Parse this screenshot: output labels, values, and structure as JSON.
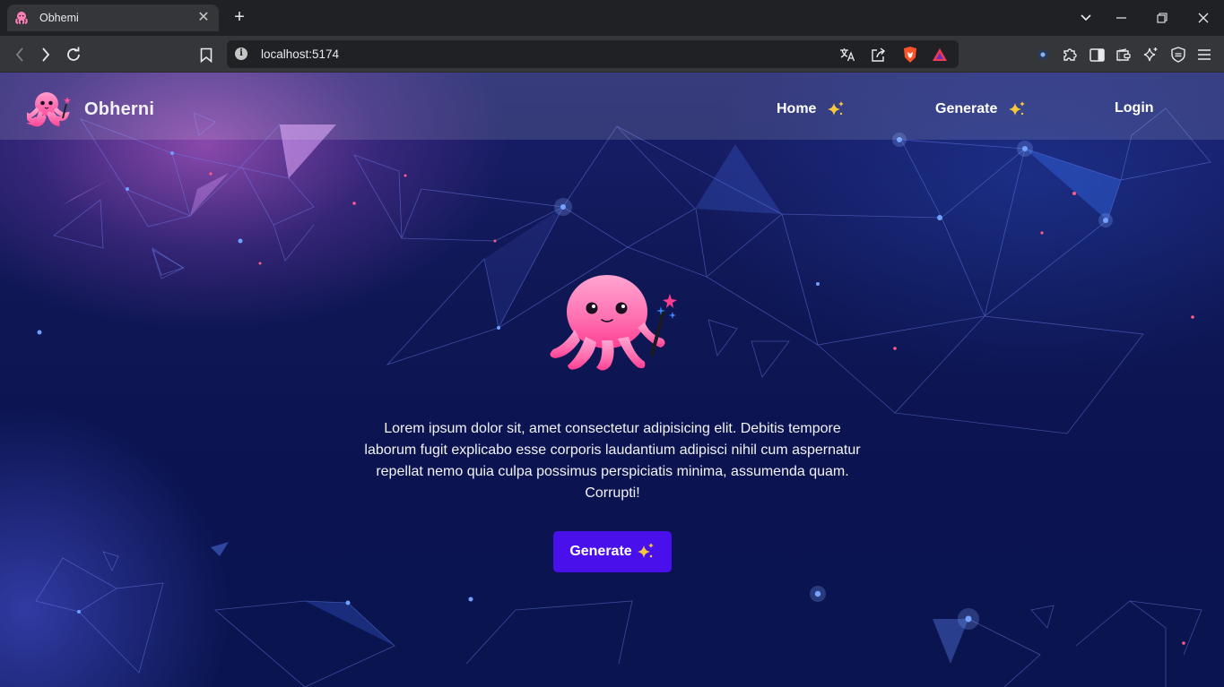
{
  "browser": {
    "tab_title": "Obhemi",
    "url": "localhost:5174"
  },
  "site": {
    "brand_name": "Obherni",
    "nav": [
      {
        "label": "Home"
      },
      {
        "label": "Generate"
      },
      {
        "label": "Login"
      }
    ],
    "hero_text": "Lorem ipsum dolor sit, amet consectetur adipisicing elit. Debitis tempore laborum fugit explicabo esse corporis laudantium adipisci nihil cum aspernatur repellat nemo quia culpa possimus perspiciatis minima, assumenda quam. Corrupti!",
    "cta_label": "Generate"
  },
  "colors": {
    "accent_button": "#4a10ec",
    "octopus_pink": "#ff6fb0",
    "background_navy": "#0b1450"
  },
  "icons": [
    "octopus-favicon",
    "close-icon",
    "plus-icon",
    "chevron-down-icon",
    "minimize-icon",
    "restore-icon",
    "window-close-icon",
    "back-icon",
    "forward-icon",
    "reload-icon",
    "bookmark-icon",
    "info-icon",
    "translate-icon",
    "share-icon",
    "brave-shield-icon",
    "brave-rewards-icon",
    "extension-badge-icon",
    "puzzle-icon",
    "sidebar-icon",
    "wallet-icon",
    "leo-icon",
    "vpn-icon",
    "menu-icon",
    "octopus-logo",
    "sparkles-icon"
  ]
}
